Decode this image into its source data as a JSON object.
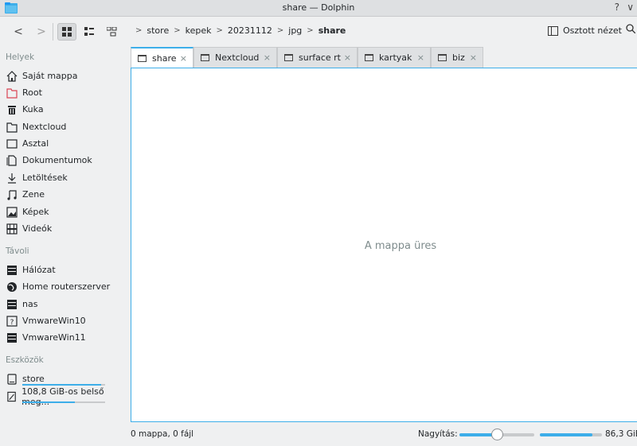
{
  "window": {
    "title": "share — Dolphin",
    "help": "?",
    "menu": "∨"
  },
  "toolbar": {
    "back": "<",
    "forward": ">",
    "breadcrumb": [
      "store",
      "kepek",
      "20231112",
      "jpg",
      "share"
    ],
    "split_label": "Osztott nézet",
    "search_icon": "search-icon"
  },
  "sidebar": {
    "places_title": "Helyek",
    "places": [
      {
        "label": "Saját mappa",
        "icon": "home-icon"
      },
      {
        "label": "Root",
        "icon": "folder-red-icon"
      },
      {
        "label": "Kuka",
        "icon": "trash-icon"
      },
      {
        "label": "Nextcloud",
        "icon": "folder-icon"
      },
      {
        "label": "Asztal",
        "icon": "desktop-icon"
      },
      {
        "label": "Dokumentumok",
        "icon": "documents-icon"
      },
      {
        "label": "Letöltések",
        "icon": "download-icon"
      },
      {
        "label": "Zene",
        "icon": "music-icon"
      },
      {
        "label": "Képek",
        "icon": "pictures-icon"
      },
      {
        "label": "Videók",
        "icon": "video-icon"
      }
    ],
    "remote_title": "Távoli",
    "remote": [
      {
        "label": "Hálózat",
        "icon": "network-icon"
      },
      {
        "label": "Home routerszerver",
        "icon": "globe-icon"
      },
      {
        "label": "nas",
        "icon": "server-icon"
      },
      {
        "label": "VmwareWin10",
        "icon": "unknown-server-icon"
      },
      {
        "label": "VmwareWin11",
        "icon": "server-icon"
      }
    ],
    "devices_title": "Eszközök",
    "devices": [
      {
        "label": "store",
        "icon": "drive-icon",
        "usage": 0.95
      },
      {
        "label": "108,8 GiB-os belső meg...",
        "icon": "drive-internal-icon",
        "usage": 0.63
      }
    ]
  },
  "tabs": [
    {
      "label": "share",
      "active": true
    },
    {
      "label": "Nextcloud",
      "active": false
    },
    {
      "label": "surface rt",
      "active": false
    },
    {
      "label": "kartyak",
      "active": false
    },
    {
      "label": "biz",
      "active": false
    }
  ],
  "tab_close": "×",
  "view": {
    "empty_message": "A mappa üres"
  },
  "status": {
    "text": "0 mappa, 0 fájl",
    "zoom_label": "Nagyítás:",
    "zoom_level": 0.5,
    "free_space_text": "86,3 GiB",
    "space_used": 0.85
  },
  "colors": {
    "accent": "#3daee9",
    "background": "#eff0f1",
    "view_bg": "#ffffff"
  }
}
